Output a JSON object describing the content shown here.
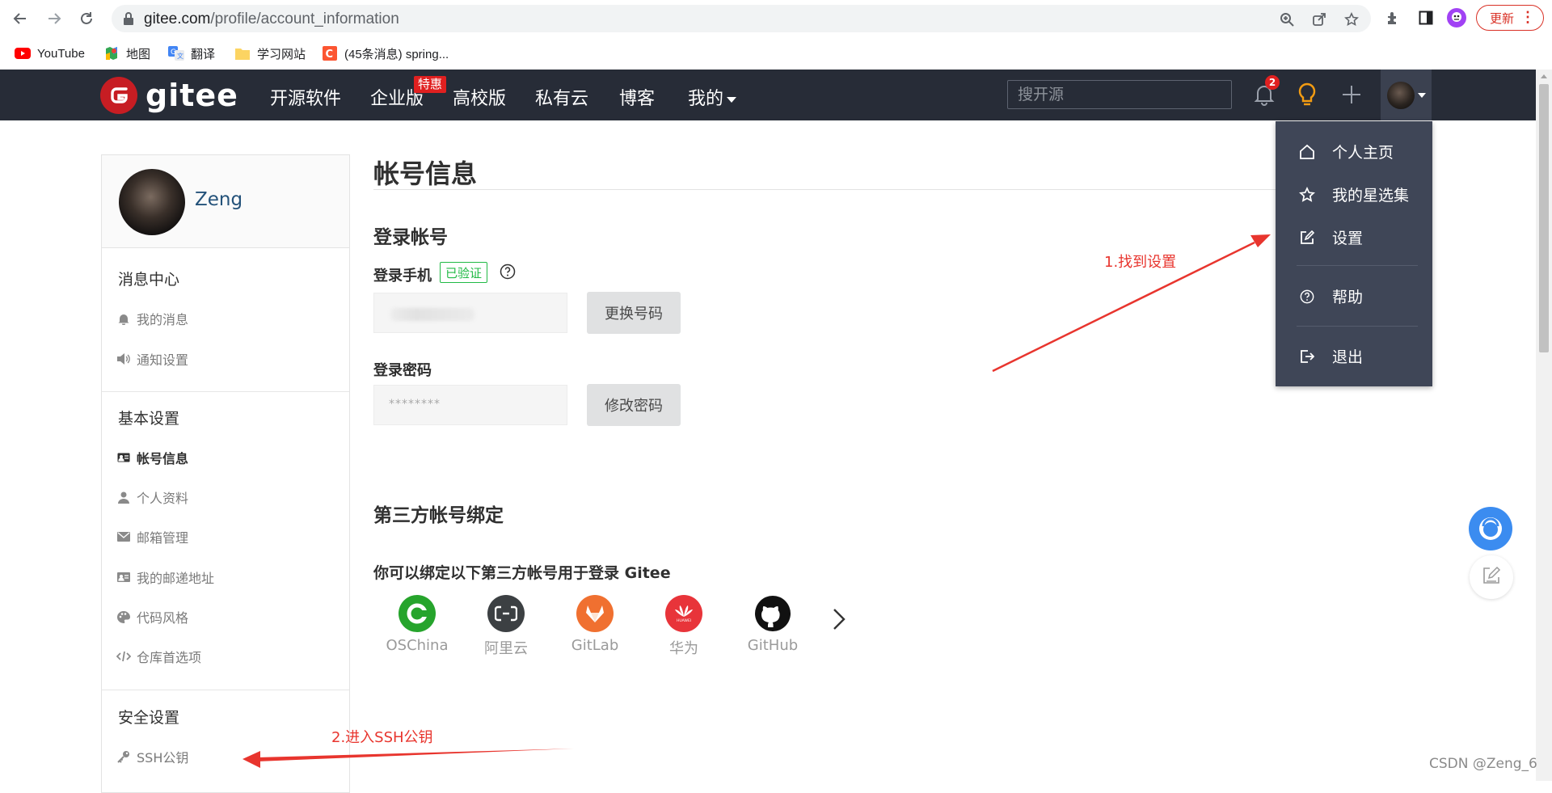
{
  "browser": {
    "url_host": "gitee.com",
    "url_path": "/profile/account_information",
    "update_label": "更新",
    "icons": [
      "back-arrow-icon",
      "forward-arrow-icon",
      "reload-icon",
      "lock-icon",
      "zoom-icon",
      "share-icon",
      "star-icon",
      "extensions-icon",
      "side-panel-icon",
      "profile-avatar-icon",
      "more-icon"
    ]
  },
  "bookmarks": [
    {
      "label": "YouTube",
      "icon": "youtube-icon"
    },
    {
      "label": "地图",
      "icon": "maps-icon"
    },
    {
      "label": "翻译",
      "icon": "translate-icon"
    },
    {
      "label": "学习网站",
      "icon": "folder-icon"
    },
    {
      "label": "(45条消息) spring...",
      "icon": "csdn-icon"
    }
  ],
  "header": {
    "logo_text": "gitee",
    "nav": [
      {
        "label": "开源软件"
      },
      {
        "label": "企业版",
        "badge": "特惠"
      },
      {
        "label": "高校版"
      },
      {
        "label": "私有云"
      },
      {
        "label": "博客"
      },
      {
        "label": "我的"
      }
    ],
    "search_placeholder": "搜开源",
    "notification_count": "2"
  },
  "dropdown": {
    "items": [
      {
        "label": "个人主页",
        "icon": "home-icon"
      },
      {
        "label": "我的星选集",
        "icon": "star-outline-icon"
      },
      {
        "label": "设置",
        "icon": "edit-icon"
      },
      {
        "label": "帮助",
        "icon": "question-icon"
      },
      {
        "label": "退出",
        "icon": "logout-icon"
      }
    ]
  },
  "sidebar": {
    "username": "Zeng",
    "sections": [
      {
        "title": "消息中心",
        "items": [
          {
            "label": "我的消息",
            "icon": "bell-icon"
          },
          {
            "label": "通知设置",
            "icon": "speaker-icon"
          }
        ]
      },
      {
        "title": "基本设置",
        "items": [
          {
            "label": "帐号信息",
            "icon": "id-card-icon",
            "active": true
          },
          {
            "label": "个人资料",
            "icon": "user-icon"
          },
          {
            "label": "邮箱管理",
            "icon": "mail-icon"
          },
          {
            "label": "我的邮递地址",
            "icon": "address-card-icon"
          },
          {
            "label": "代码风格",
            "icon": "palette-icon"
          },
          {
            "label": "仓库首选项",
            "icon": "code-icon"
          }
        ]
      },
      {
        "title": "安全设置",
        "items": [
          {
            "label": "SSH公钥",
            "icon": "key-icon"
          }
        ]
      }
    ]
  },
  "main": {
    "title": "帐号信息",
    "login_account": {
      "heading": "登录帐号",
      "phone_label": "登录手机",
      "verified": "已验证",
      "change_phone_button": "更换号码",
      "password_label": "登录密码",
      "password_mask": "********",
      "change_password_button": "修改密码"
    },
    "third_party": {
      "heading": "第三方帐号绑定",
      "description": "你可以绑定以下第三方帐号用于登录 Gitee",
      "providers": [
        {
          "label": "OSChina",
          "color": "#26a42c"
        },
        {
          "label": "阿里云",
          "color": "#3c4043"
        },
        {
          "label": "GitLab",
          "color": "#f07030"
        },
        {
          "label": "华为",
          "color": "#e8343a"
        },
        {
          "label": "GitHub",
          "color": "#111111"
        }
      ]
    }
  },
  "annotations": {
    "step1": "1.找到设置",
    "step2": "2.进入SSH公钥",
    "color": "#e8352e"
  },
  "watermark": "CSDN @Zeng_6",
  "colors": {
    "header_bg": "#272c37",
    "dropdown_bg": "#3f4657",
    "brand_red": "#c71d23",
    "verified_green": "#21ba45"
  }
}
